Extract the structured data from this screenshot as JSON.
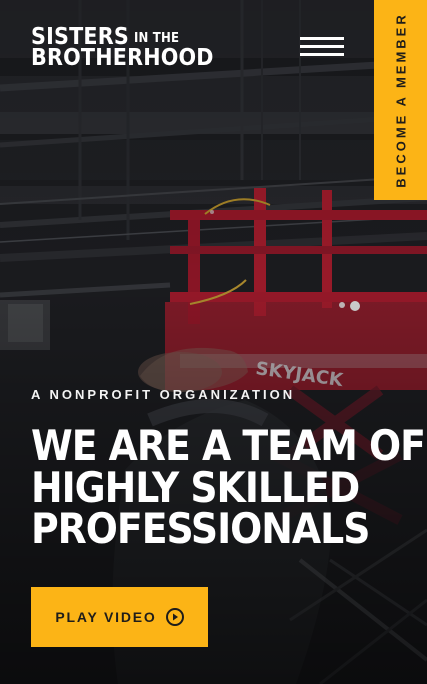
{
  "brand": {
    "line1": "SISTERS",
    "line1_small": "IN THE",
    "line2": "BROTHERHOOD"
  },
  "header": {
    "menu_icon": "hamburger-menu-icon",
    "member_cta": "BECOME A MEMBER"
  },
  "background": {
    "sign_text": "SKYJACK"
  },
  "hero": {
    "eyebrow": "A NONPROFIT ORGANIZATION",
    "headline_lines": [
      "WE ARE A TEAM OF",
      "HIGHLY SKILLED",
      "PROFESSIONALS"
    ],
    "play_button_label": "PLAY VIDEO",
    "play_icon": "play-circle-icon"
  },
  "colors": {
    "accent": "#fcb416",
    "accent_text": "#1f1d1a",
    "hero_text": "#ffffff",
    "lift_red": "#b51f31"
  }
}
